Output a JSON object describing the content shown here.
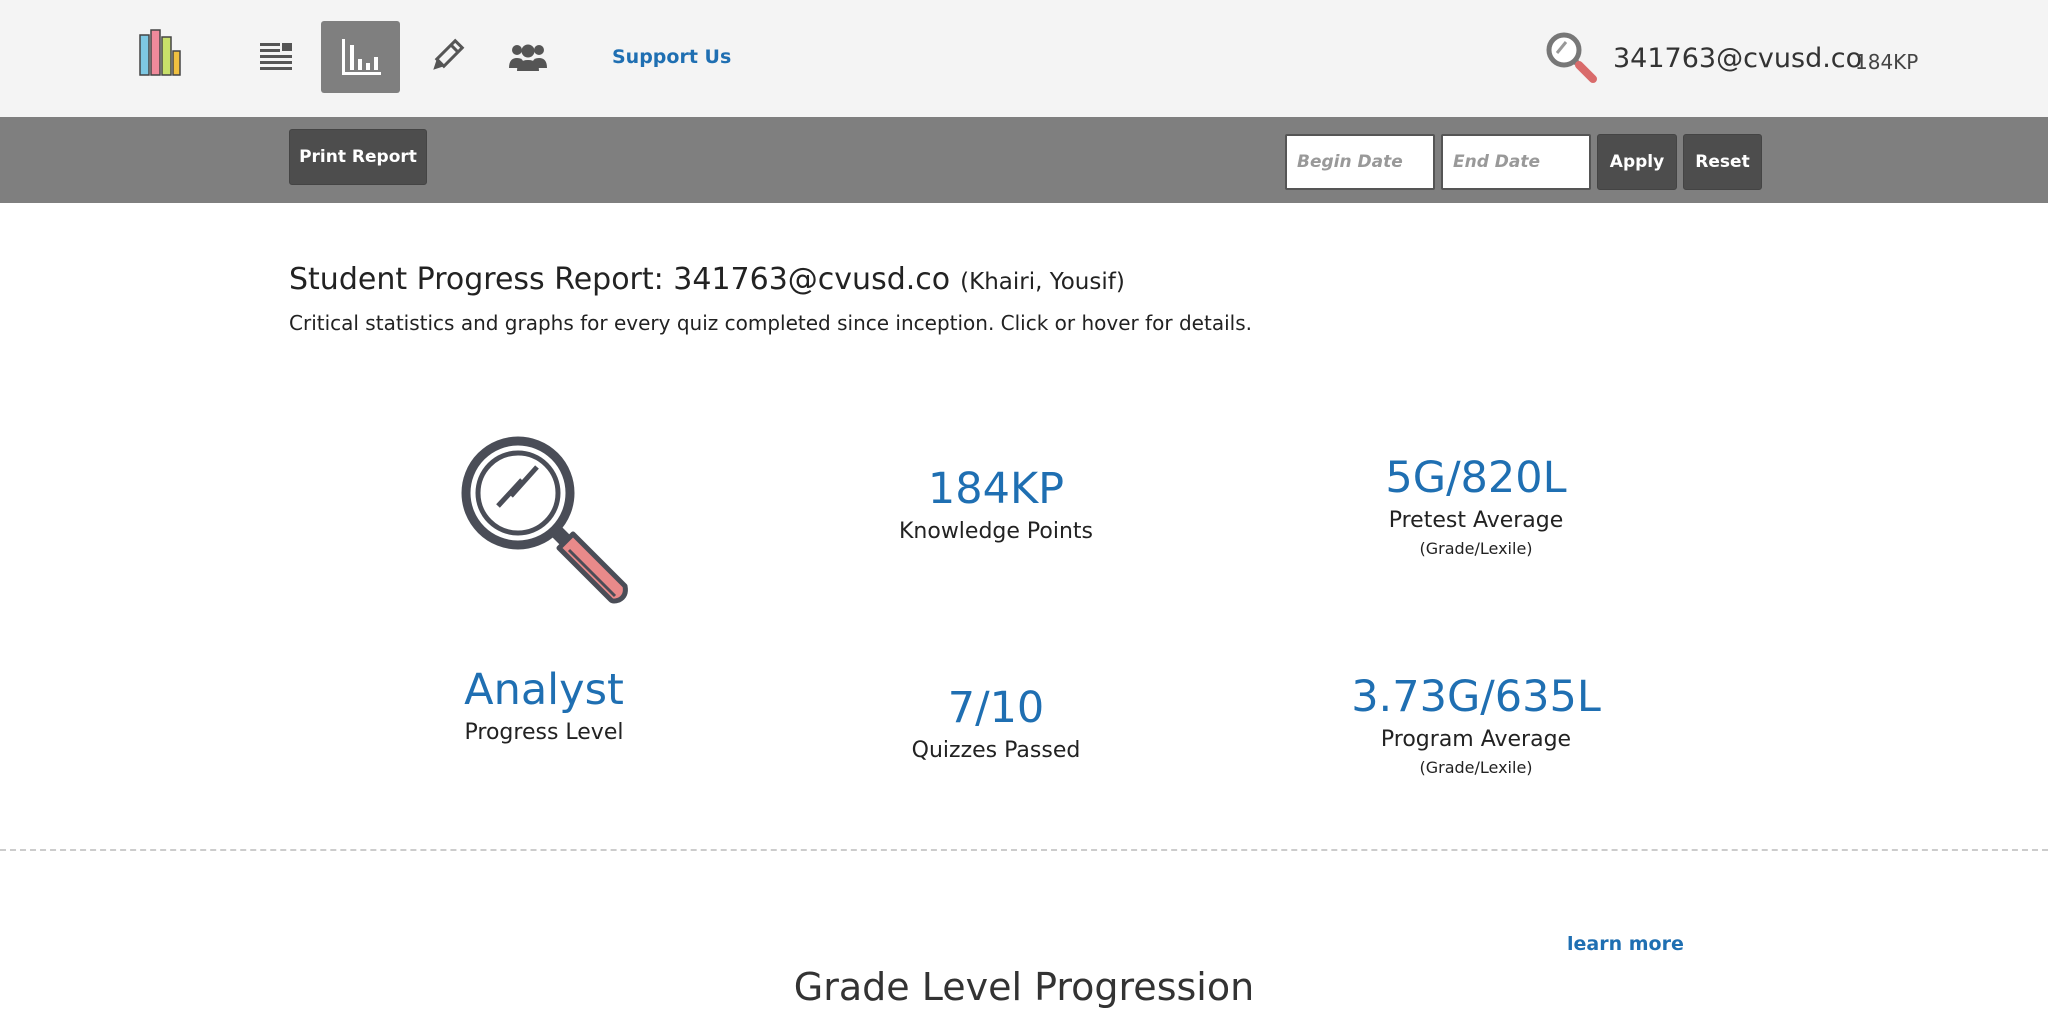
{
  "nav": {
    "support_label": "Support Us",
    "user": "341763@cvusd.co",
    "kp": "184KP",
    "active_icon": "bar-chart-icon",
    "icons": [
      "library-logo-icon",
      "list-icon",
      "bar-chart-icon",
      "pencil-icon",
      "group-icon",
      "search-icon"
    ]
  },
  "toolbar": {
    "print_label": "Print Report",
    "begin_placeholder": "Begin Date",
    "end_placeholder": "End Date",
    "apply_label": "Apply",
    "reset_label": "Reset"
  },
  "report": {
    "title": "Student Progress Report: 341763@cvusd.co",
    "student_name": "(Khairi, Yousif)",
    "subtitle": "Critical statistics and graphs for every quiz completed since inception. Click or hover for details."
  },
  "stats": {
    "kp": {
      "value": "184KP",
      "label": "Knowledge Points"
    },
    "pretest": {
      "value": "5G/820L",
      "label": "Pretest Average",
      "sub": "(Grade/Lexile)"
    },
    "level": {
      "value": "Analyst",
      "label": "Progress Level"
    },
    "quizzes": {
      "value": "7/10",
      "label": "Quizzes Passed"
    },
    "program": {
      "value": "3.73G/635L",
      "label": "Program Average",
      "sub": "(Grade/Lexile)"
    }
  },
  "section": {
    "learn_more": "learn more",
    "title": "Grade Level Progression"
  },
  "colors": {
    "accent": "#1f6fb2",
    "nav_bg": "#f4f4f4",
    "toolbar_bg": "#7f7f7f",
    "button_bg": "#4d4d4d",
    "magnifier_handle": "#e98a8a"
  }
}
